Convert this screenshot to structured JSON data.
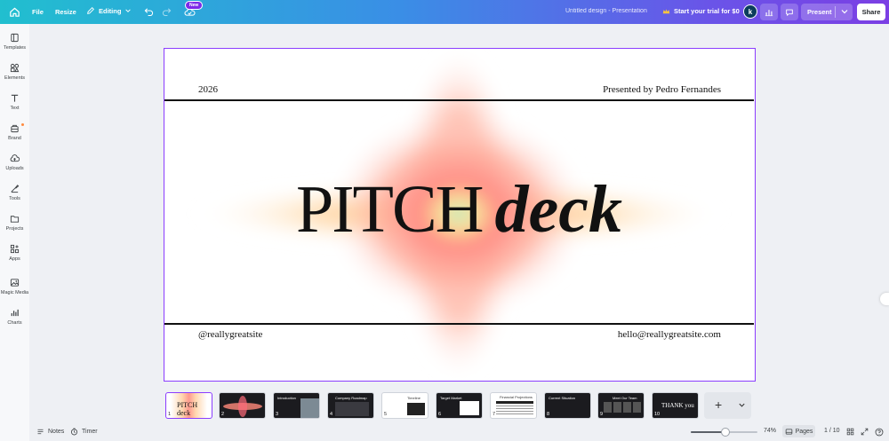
{
  "topbar": {
    "file_label": "File",
    "resize_label": "Resize",
    "editing_label": "Editing",
    "new_badge": "New",
    "doc_title": "Untitled design - Presentation",
    "trial_label": "Start your trial for $0",
    "avatar_letter": "k",
    "present_label": "Present",
    "share_label": "Share"
  },
  "sidebar": {
    "items": [
      {
        "label": "Templates",
        "icon": "templates-icon"
      },
      {
        "label": "Elements",
        "icon": "elements-icon"
      },
      {
        "label": "Text",
        "icon": "text-icon"
      },
      {
        "label": "Brand",
        "icon": "brand-icon"
      },
      {
        "label": "Uploads",
        "icon": "uploads-icon"
      },
      {
        "label": "Tools",
        "icon": "tools-icon"
      },
      {
        "label": "Projects",
        "icon": "projects-icon"
      },
      {
        "label": "Apps",
        "icon": "apps-icon"
      },
      {
        "label": "Magic Media",
        "icon": "magic-media-icon"
      },
      {
        "label": "Charts",
        "icon": "charts-icon"
      }
    ]
  },
  "slide": {
    "year": "2026",
    "presenter": "Presented by Pedro Fernandes",
    "heading_1": "PITCH",
    "heading_2": "deck",
    "handle": "@reallygreatsite",
    "email": "hello@reallygreatsite.com"
  },
  "pages": [
    {
      "num": "1",
      "title": "PITCH deck",
      "active": true
    },
    {
      "num": "2",
      "title": ""
    },
    {
      "num": "3",
      "title": "Introduction"
    },
    {
      "num": "4",
      "title": "Company Roadmap"
    },
    {
      "num": "5",
      "title": "Timeline"
    },
    {
      "num": "6",
      "title": "Target Market"
    },
    {
      "num": "7",
      "title": "Financial Projections"
    },
    {
      "num": "8",
      "title": "Current Situation"
    },
    {
      "num": "9",
      "title": "Meet Our Team"
    },
    {
      "num": "10",
      "title": "THANK you"
    }
  ],
  "footer": {
    "notes_label": "Notes",
    "timer_label": "Timer",
    "zoom_percent": "74%",
    "zoom_level": 0.52,
    "pages_label": "Pages",
    "page_counter": "1 / 10"
  },
  "colors": {
    "accent": "#8b3dff",
    "topbar_start": "#21bfcf",
    "topbar_end": "#7b3fe4"
  }
}
